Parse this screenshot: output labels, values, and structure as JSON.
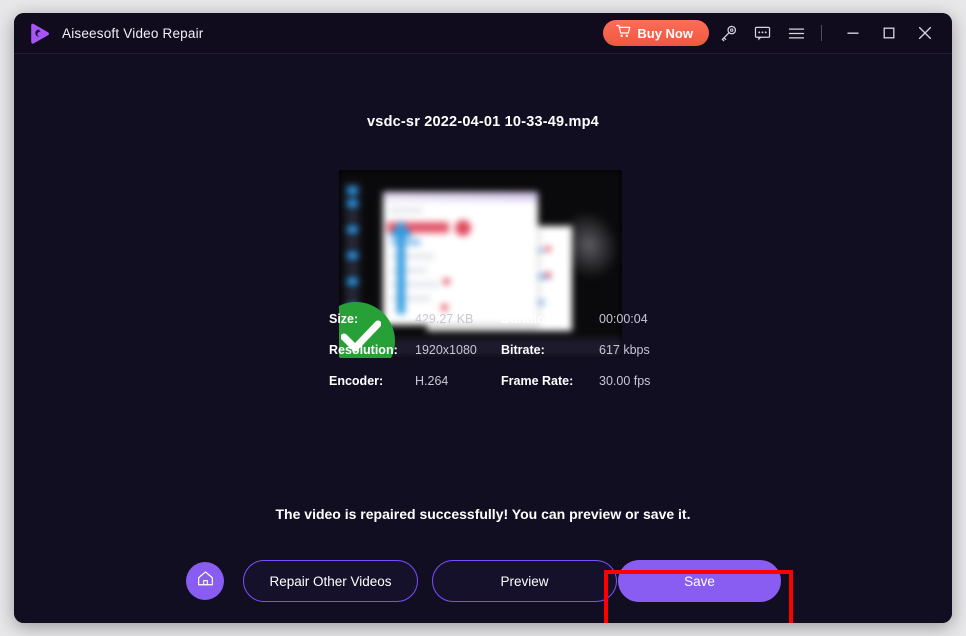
{
  "window": {
    "app_title": "Aiseesoft Video Repair",
    "logo_icon": "play-triangle-logo",
    "buy_now_label": "Buy Now",
    "cart_icon": "shopping-cart-icon",
    "key_icon": "key-icon",
    "feedback_icon": "speech-bubble-icon",
    "menu_icon": "hamburger-menu-icon",
    "minimize_icon": "minimize-icon",
    "maximize_icon": "maximize-icon",
    "close_icon": "close-icon"
  },
  "main": {
    "file_name": "vsdc-sr 2022-04-01 10-33-49.mp4",
    "thumbnail_badge_icon": "green-check-badge",
    "status_message": "The video is repaired successfully! You can preview or save it.",
    "metadata": [
      {
        "key": "Size:",
        "value": "429.27 KB",
        "key2": "Duration:",
        "value2": "00:00:04"
      },
      {
        "key": "Resolution:",
        "value": "1920x1080",
        "key2": "Bitrate:",
        "value2": "617 kbps"
      },
      {
        "key": "Encoder:",
        "value": "H.264",
        "key2": "Frame Rate:",
        "value2": "30.00 fps"
      }
    ]
  },
  "actions": {
    "home_icon": "home-icon",
    "repair_other_label": "Repair Other Videos",
    "preview_label": "Preview",
    "save_label": "Save"
  },
  "colors": {
    "window_bg": "#120e22",
    "titlebar_bg": "#100c1e",
    "accent_purple": "#8a5df2",
    "outline_purple": "#7c4dff",
    "buy_now_orange": "#f4654e",
    "highlight_red": "#ff0000",
    "success_green": "#28a038"
  }
}
